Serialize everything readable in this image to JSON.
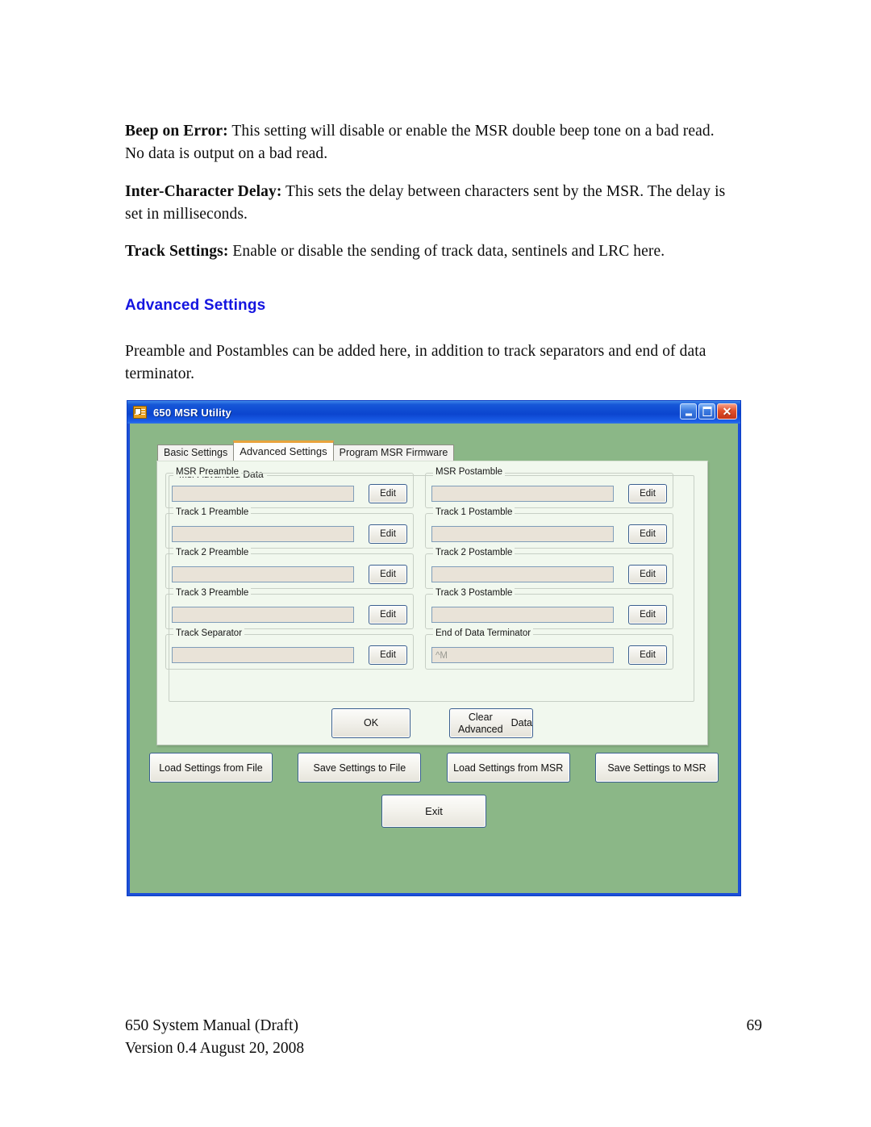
{
  "document": {
    "paragraphs": [
      {
        "lead": "Beep on Error:",
        "text": " This setting will disable or enable the MSR double beep tone on a bad read. No data is output on a bad read."
      },
      {
        "lead": "Inter-Character Delay:",
        "text": "  This sets the delay between characters sent by the MSR. The delay is set in milliseconds."
      },
      {
        "lead": "Track Settings:",
        "text": "  Enable or disable the sending of track data, sentinels and LRC here."
      }
    ],
    "heading": "Advanced Settings",
    "heading_color": "#1414e0",
    "body_paragraph": "Preamble and Postambles can be added here, in addition to track separators and end of data terminator."
  },
  "screenshot": {
    "window": {
      "title": "650 MSR Utility",
      "icon": "app-card-icon",
      "titlebar_color": "#0b45cf",
      "body_color": "#8bb787",
      "controls": {
        "minimize": "_",
        "maximize": "□",
        "close": "✕"
      }
    },
    "tabs": [
      {
        "label": "Basic Settings",
        "selected": false
      },
      {
        "label": "Advanced Settings",
        "selected": true
      },
      {
        "label": "Program MSR Firmware",
        "selected": false
      }
    ],
    "group": {
      "legend": "Msr Advanced Data"
    },
    "fields": [
      {
        "label": "MSR Preamble",
        "value": "",
        "button": "Edit"
      },
      {
        "label": "MSR Postamble",
        "value": "",
        "button": "Edit"
      },
      {
        "label": "Track 1 Preamble",
        "value": "",
        "button": "Edit"
      },
      {
        "label": "Track 1 Postamble",
        "value": "",
        "button": "Edit"
      },
      {
        "label": "Track 2 Preamble",
        "value": "",
        "button": "Edit"
      },
      {
        "label": "Track 2 Postamble",
        "value": "",
        "button": "Edit"
      },
      {
        "label": "Track 3 Preamble",
        "value": "",
        "button": "Edit"
      },
      {
        "label": "Track 3 Postamble",
        "value": "",
        "button": "Edit"
      },
      {
        "label": "Track Separator",
        "value": "",
        "button": "Edit"
      },
      {
        "label": "End of Data Terminator",
        "value": "^M",
        "button": "Edit"
      }
    ],
    "panel_actions": {
      "ok": "OK",
      "clear": "Clear Advanced\nData",
      "clear_line1": "Clear Advanced",
      "clear_line2": "Data"
    },
    "bottom_buttons": [
      "Load Settings from File",
      "Save Settings to File",
      "Load Settings from MSR",
      "Save Settings to MSR"
    ],
    "exit_button": "Exit"
  },
  "footer": {
    "manual": "650 System Manual (Draft)",
    "page": "69",
    "version": "Version 0.4 August 20, 2008"
  }
}
